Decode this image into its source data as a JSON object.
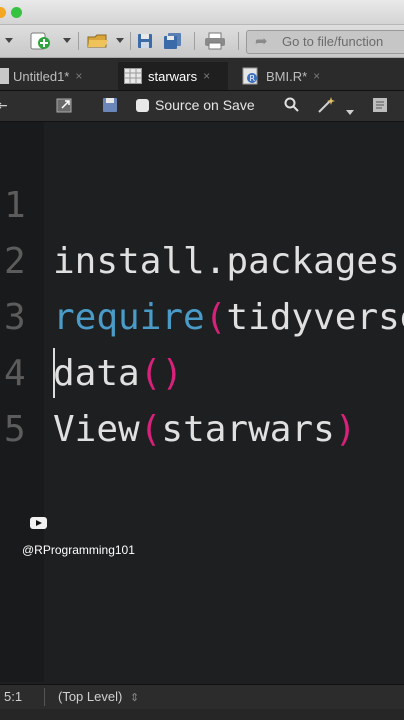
{
  "toolbar": {
    "goto_placeholder": "Go to file/function"
  },
  "tabs": [
    {
      "label": "Untitled1*"
    },
    {
      "label": "starwars"
    },
    {
      "label": "BMI.R*"
    }
  ],
  "editor_toolbar": {
    "source_on_save": "Source on Save"
  },
  "code": {
    "lines": [
      {
        "num": "1",
        "text": "install.packages"
      },
      {
        "num": "2",
        "kw": "require",
        "paren_open": "(",
        "rest": "tidyverse"
      },
      {
        "num": "3",
        "text": "data",
        "parens": "()"
      },
      {
        "num": "4",
        "text": "View",
        "paren_open": "(",
        "arg": "starwars",
        "paren_close": ")"
      },
      {
        "num": "5"
      }
    ]
  },
  "overlay": {
    "handle": "@RProgramming101",
    "icon": "youtube-icon"
  },
  "status": {
    "position": "5:1",
    "scope": "(Top Level)"
  },
  "colors": {
    "keyword": "#4a9bc7",
    "paren": "#d7217a",
    "text": "#e0e0e0",
    "background": "#1d1f21"
  }
}
